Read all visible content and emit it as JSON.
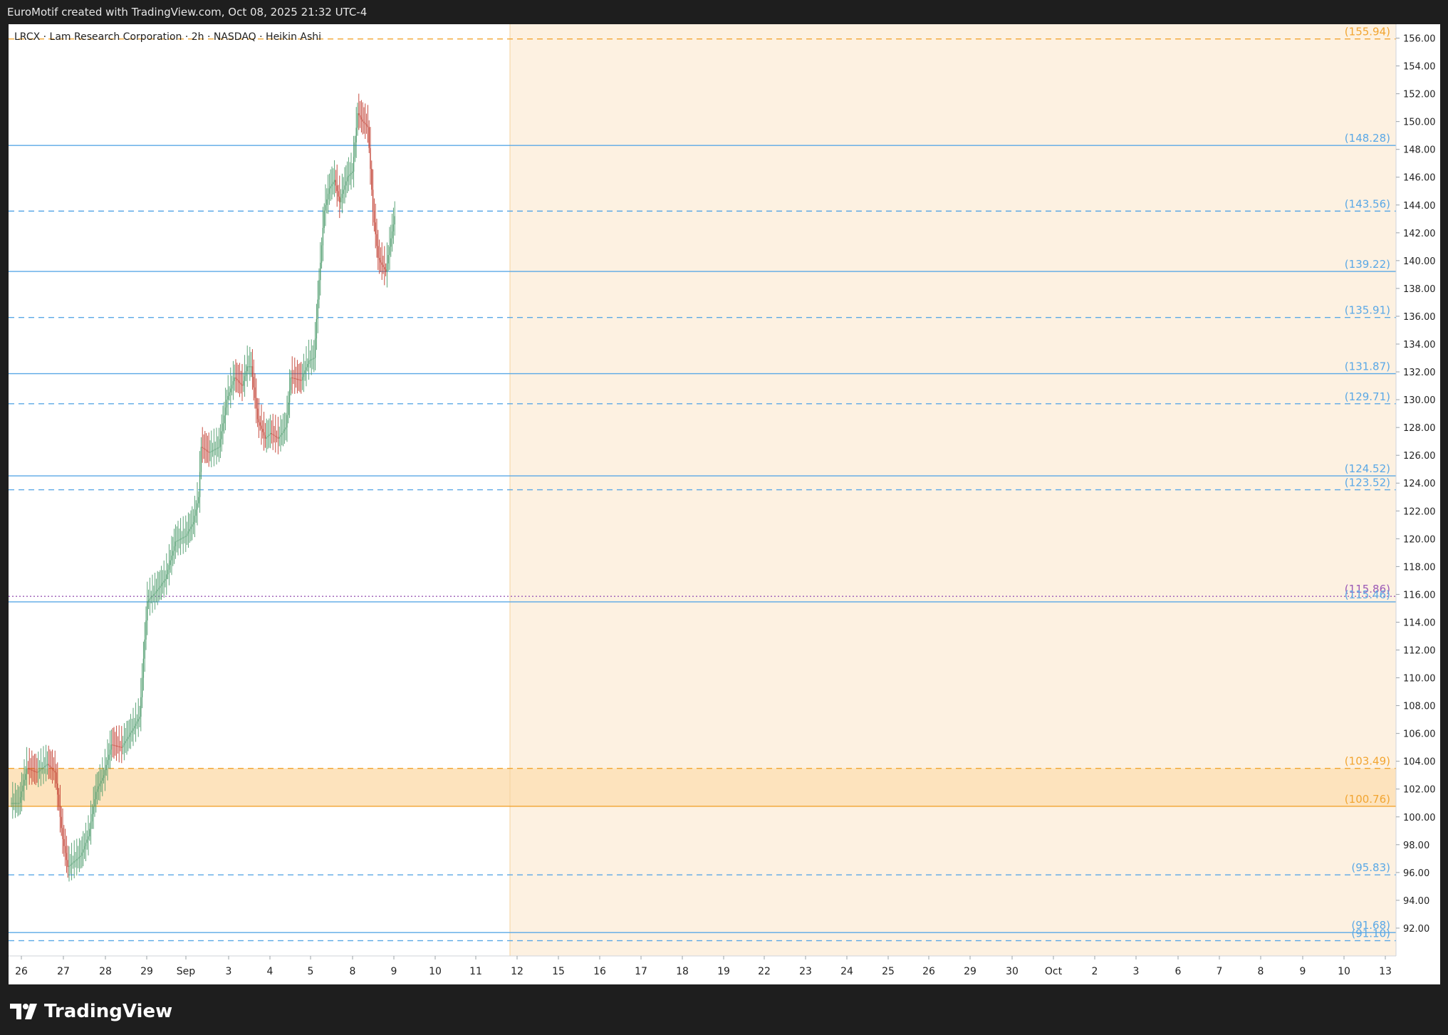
{
  "attribution": "EuroMotif created with TradingView.com, Oct 08, 2025 21:32 UTC-4",
  "brand": "TradingView",
  "colors": {
    "up": "#4b9a6a",
    "down": "#c0392b",
    "blue_level": "#5aa8e6",
    "orange_level": "#f2a531",
    "shade": "#fdf1e1",
    "band": "#fde3bd",
    "session_line": "#f5d29c"
  },
  "chart_data": {
    "type": "candlestick",
    "title": "LRCX · Lam Research Corporation · 2h · NASDAQ · Heikin Ashi",
    "ylim": [
      90.0,
      157.0
    ],
    "y_ticks": [
      "92.00",
      "94.00",
      "96.00",
      "98.00",
      "100.00",
      "102.00",
      "104.00",
      "106.00",
      "108.00",
      "110.00",
      "112.00",
      "114.00",
      "116.00",
      "118.00",
      "120.00",
      "122.00",
      "124.00",
      "126.00",
      "128.00",
      "130.00",
      "132.00",
      "134.00",
      "136.00",
      "138.00",
      "140.00",
      "142.00",
      "144.00",
      "146.00",
      "148.00",
      "150.00",
      "152.00",
      "154.00",
      "156.00"
    ],
    "x_ticks": [
      "26",
      "27",
      "28",
      "29",
      "Sep",
      "3",
      "4",
      "5",
      "8",
      "9",
      "10",
      "11",
      "12",
      "15",
      "16",
      "17",
      "18",
      "19",
      "22",
      "23",
      "24",
      "25",
      "26",
      "29",
      "30",
      "Oct",
      "2",
      "3",
      "6",
      "7",
      "8",
      "9",
      "10",
      "13"
    ],
    "levels": [
      {
        "value": 155.94,
        "label": "(155.94)",
        "style": "dashed",
        "color": "orange"
      },
      {
        "value": 148.28,
        "label": "(148.28)",
        "style": "solid",
        "color": "blue"
      },
      {
        "value": 143.56,
        "label": "(143.56)",
        "style": "dashed",
        "color": "blue"
      },
      {
        "value": 139.22,
        "label": "(139.22)",
        "style": "solid",
        "color": "blue"
      },
      {
        "value": 135.91,
        "label": "(135.91)",
        "style": "dashed",
        "color": "blue"
      },
      {
        "value": 131.87,
        "label": "(131.87)",
        "style": "solid",
        "color": "blue"
      },
      {
        "value": 129.71,
        "label": "(129.71)",
        "style": "dashed",
        "color": "blue"
      },
      {
        "value": 124.52,
        "label": "(124.52)",
        "style": "solid",
        "color": "blue"
      },
      {
        "value": 123.52,
        "label": "(123.52)",
        "style": "dashed",
        "color": "blue"
      },
      {
        "value": 115.86,
        "label": "(115.86)",
        "style": "dotted",
        "color": "purple"
      },
      {
        "value": 115.46,
        "label": "(115.46)",
        "style": "solid",
        "color": "blue"
      },
      {
        "value": 103.49,
        "label": "(103.49)",
        "style": "dashed",
        "color": "orange"
      },
      {
        "value": 100.76,
        "label": "(100.76)",
        "style": "solid",
        "color": "orange"
      },
      {
        "value": 95.83,
        "label": "(95.83)",
        "style": "dashed",
        "color": "blue"
      },
      {
        "value": 91.68,
        "label": "(91.68)",
        "style": "solid",
        "color": "blue"
      },
      {
        "value": 91.1,
        "label": "(91.10)",
        "style": "dashed",
        "color": "blue"
      }
    ],
    "keypoints": [
      [
        0,
        101.0
      ],
      [
        6,
        101.0
      ],
      [
        12,
        103.5
      ],
      [
        20,
        103.2
      ],
      [
        28,
        103.8
      ],
      [
        34,
        103.2
      ],
      [
        40,
        98.4
      ],
      [
        44,
        96.4
      ],
      [
        54,
        97.2
      ],
      [
        60,
        98.6
      ],
      [
        66,
        101.8
      ],
      [
        72,
        103.0
      ],
      [
        78,
        105.2
      ],
      [
        86,
        105.0
      ],
      [
        94,
        106.2
      ],
      [
        100,
        107.2
      ],
      [
        102,
        110.0
      ],
      [
        106,
        115.5
      ],
      [
        112,
        116.1
      ],
      [
        120,
        117.1
      ],
      [
        128,
        119.8
      ],
      [
        136,
        120.2
      ],
      [
        142,
        121.2
      ],
      [
        146,
        123.0
      ],
      [
        148,
        126.6
      ],
      [
        154,
        126.2
      ],
      [
        162,
        126.6
      ],
      [
        168,
        130.0
      ],
      [
        174,
        131.6
      ],
      [
        180,
        131.0
      ],
      [
        184,
        132.4
      ],
      [
        187,
        132.4
      ],
      [
        192,
        128.6
      ],
      [
        198,
        127.2
      ],
      [
        202,
        127.6
      ],
      [
        208,
        127.2
      ],
      [
        214,
        128.0
      ],
      [
        218,
        131.6
      ],
      [
        226,
        131.4
      ],
      [
        232,
        132.8
      ],
      [
        236,
        133.0
      ],
      [
        240,
        138.6
      ],
      [
        244,
        143.6
      ],
      [
        248,
        145.2
      ],
      [
        252,
        145.8
      ],
      [
        256,
        144.2
      ],
      [
        262,
        146.0
      ],
      [
        266,
        146.4
      ],
      [
        270,
        150.6
      ],
      [
        274,
        150.0
      ],
      [
        278,
        149.6
      ],
      [
        282,
        143.6
      ],
      [
        286,
        140.2
      ],
      [
        292,
        139.2
      ],
      [
        296,
        141.6
      ],
      [
        298,
        142.6
      ],
      [
        299,
        143.2
      ]
    ],
    "candle_count": 300
  }
}
